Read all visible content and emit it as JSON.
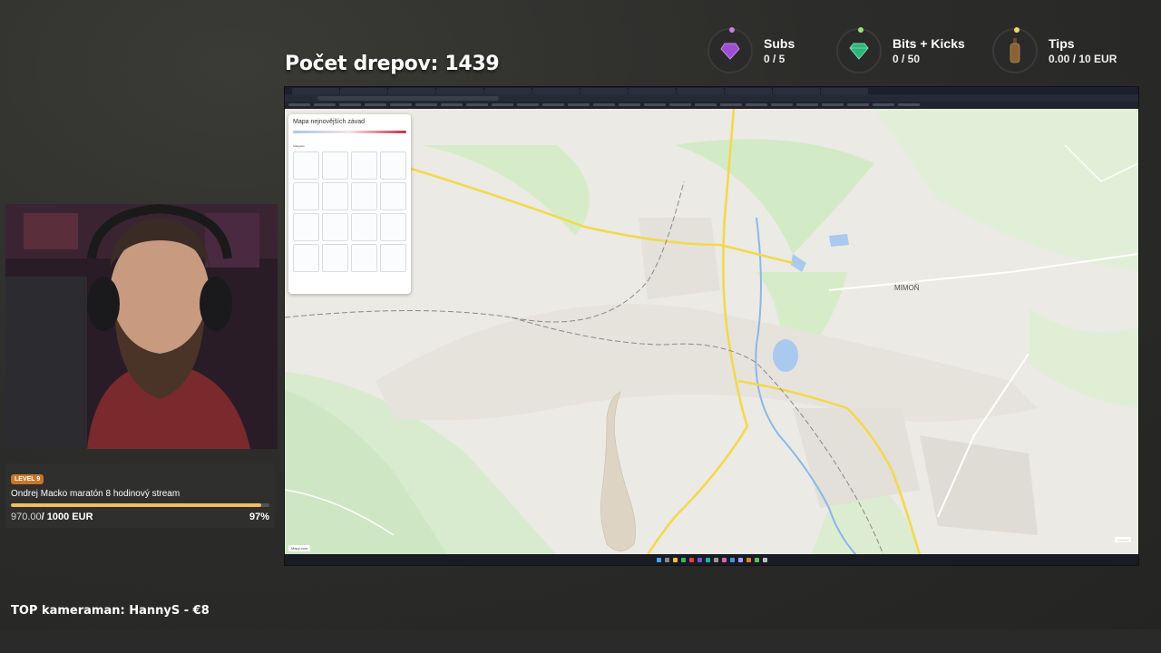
{
  "counter": {
    "title": "Počet drepov: 1439"
  },
  "goals": [
    {
      "label": "Subs",
      "value": "0 / 5",
      "icon": "purple-heart-gem-icon",
      "dot_color": "#c87ee0"
    },
    {
      "label": "Bits + Kicks",
      "value": "0 / 50",
      "icon": "green-gem-icon",
      "dot_color": "#9de07a"
    },
    {
      "label": "Tips",
      "value": "0.00 / 10 EUR",
      "icon": "bottle-icon",
      "dot_color": "#e8d86a"
    }
  ],
  "map_panel": {
    "title": "Mapa nejnovějších závad",
    "category_label": "Kategorie",
    "logo": "Mapy.com"
  },
  "map_labels": {
    "town": "MIMOŇ"
  },
  "stream_goal": {
    "level": "LEVEL 9",
    "title": "Ondrej Macko maratón 8 hodinový stream",
    "current": "970.00",
    "total": "/ 1000 EUR",
    "percent_label": "97%",
    "progress": 0.97
  },
  "top_kameraman": "TOP kameraman: HannyS - €8"
}
